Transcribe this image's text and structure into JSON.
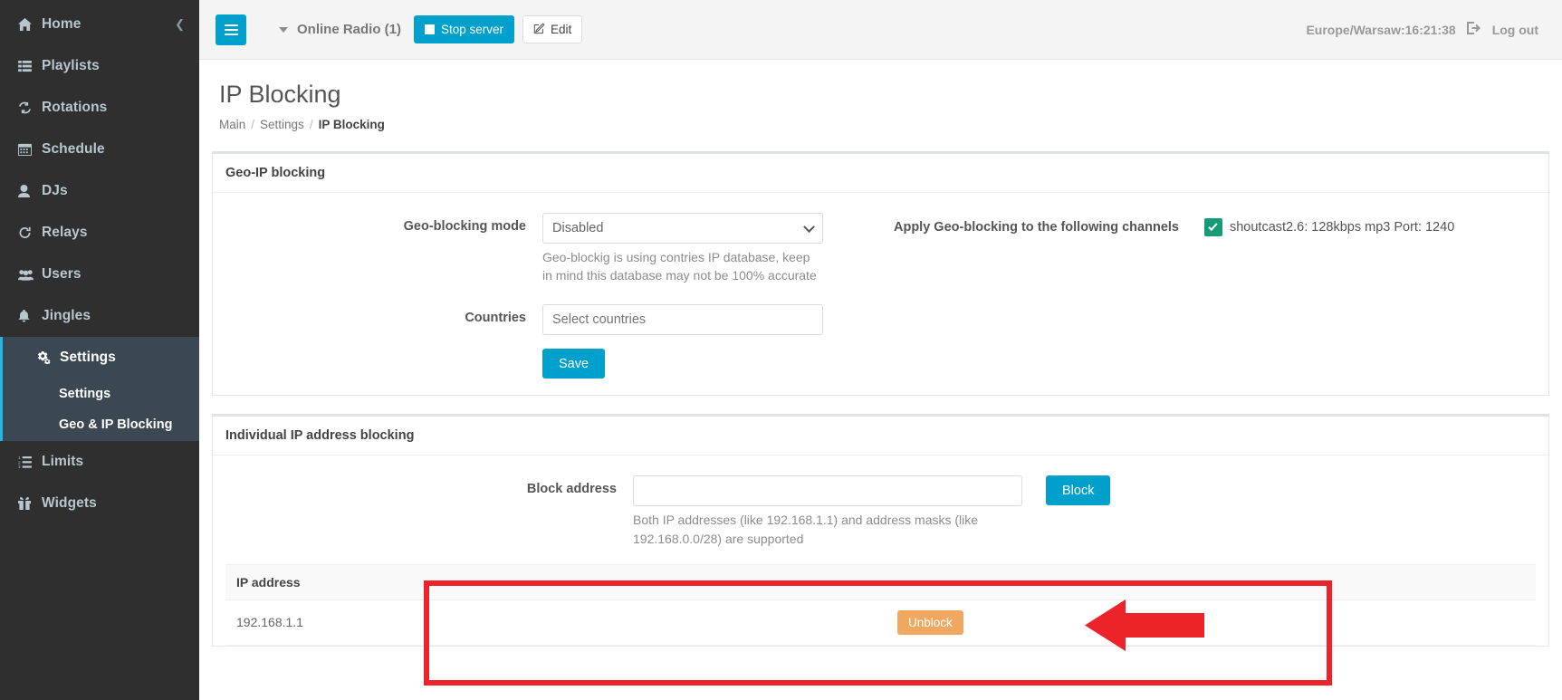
{
  "sidebar": {
    "items": [
      {
        "label": "Home",
        "icon": "home-icon",
        "trailing": "chevron-left-icon"
      },
      {
        "label": "Playlists",
        "icon": "list-icon"
      },
      {
        "label": "Rotations",
        "icon": "refresh-icon"
      },
      {
        "label": "Schedule",
        "icon": "calendar-icon"
      },
      {
        "label": "DJs",
        "icon": "user-icon"
      },
      {
        "label": "Relays",
        "icon": "reload-icon"
      },
      {
        "label": "Users",
        "icon": "users-icon"
      },
      {
        "label": "Jingles",
        "icon": "bell-icon"
      },
      {
        "label": "Settings",
        "icon": "gears-icon",
        "active": true
      },
      {
        "label": "Limits",
        "icon": "ordered-list-icon"
      },
      {
        "label": "Widgets",
        "icon": "gift-icon"
      }
    ],
    "sub_items": [
      {
        "label": "Settings"
      },
      {
        "label": "Geo & IP Blocking"
      }
    ]
  },
  "topbar": {
    "menu_toggle": "hamburger-icon",
    "station_name": "Online Radio (1)",
    "stop_server_label": "Stop server",
    "edit_label": "Edit",
    "clock": "Europe/Warsaw:16:21:38",
    "logout_label": "Log out"
  },
  "page": {
    "title": "IP Blocking",
    "breadcrumb": [
      {
        "label": "Main",
        "active": false
      },
      {
        "label": "Settings",
        "active": false
      },
      {
        "label": "IP Blocking",
        "active": true
      }
    ]
  },
  "geo_panel": {
    "heading": "Geo-IP blocking",
    "mode_label": "Geo-blocking mode",
    "mode_value": "Disabled",
    "mode_options": [
      "Disabled"
    ],
    "mode_help": "Geo-blockig is using contries IP database, keep in mind this database may not be 100% accurate",
    "countries_label": "Countries",
    "countries_placeholder": "Select countries",
    "countries_value": "",
    "save_label": "Save",
    "channels_label": "Apply Geo-blocking to the following channels",
    "channels": [
      {
        "label": "shoutcast2.6: 128kbps mp3 Port: 1240",
        "checked": true
      }
    ]
  },
  "ip_panel": {
    "heading": "Individual IP address blocking",
    "block_label": "Block address",
    "block_value": "",
    "block_placeholder": "",
    "block_button": "Block",
    "block_help": "Both IP addresses (like 192.168.1.1) and address masks (like 192.168.0.0/28) are supported",
    "table": {
      "columns": [
        "IP address",
        "",
        ""
      ],
      "rows": [
        {
          "ip": "192.168.1.1",
          "action": "Unblock"
        }
      ]
    }
  },
  "annotations": {
    "highlight_color": "#ee2229",
    "arrow": "left-arrow-annotation",
    "box": "red-highlight-box"
  },
  "colors": {
    "accent": "#00a0cd",
    "sidebar_bg": "#2f2f2f",
    "sidebar_active_bg": "#3b4752",
    "sidebar_active_bar": "#2ab5e0",
    "checkbox_green": "#179b77",
    "unblock_orange": "#f0a860",
    "annotation_red": "#ee2229"
  }
}
